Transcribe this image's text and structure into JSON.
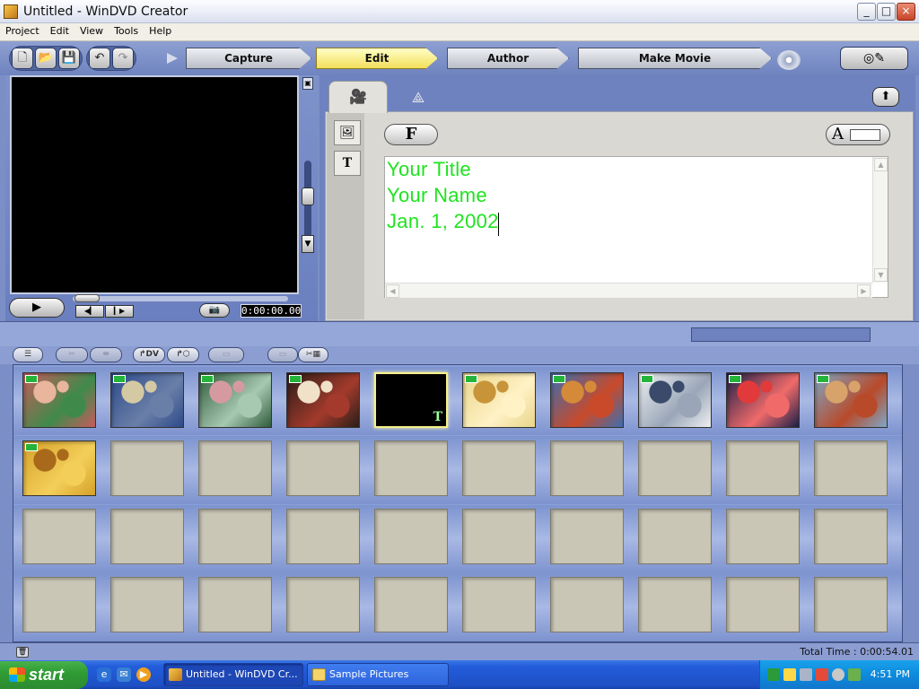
{
  "window": {
    "title": "Untitled - WinDVD Creator"
  },
  "window_controls": {
    "minimize": "_",
    "maximize": "□",
    "close": "×"
  },
  "menu": [
    "Project",
    "Edit",
    "View",
    "Tools",
    "Help"
  ],
  "toolbar": {
    "steps": [
      {
        "label": "Capture",
        "active": false
      },
      {
        "label": "Edit",
        "active": true
      },
      {
        "label": "Author",
        "active": false
      },
      {
        "label": "Make Movie",
        "active": false
      }
    ]
  },
  "preview": {
    "timecode": "0:00:00.00"
  },
  "editor": {
    "font_button": "F",
    "align_button": "A",
    "title_lines": [
      "Your Title",
      "Your Name",
      "Jan. 1, 2002"
    ],
    "text_color": "#1ee31e"
  },
  "clips": [
    {
      "type": "image",
      "colors": [
        "#c75c5c",
        "#e9b59c",
        "#3f8a4b"
      ],
      "badge": true
    },
    {
      "type": "image",
      "colors": [
        "#2d4a8a",
        "#d5c9a3",
        "#6a7fa8"
      ],
      "badge": true
    },
    {
      "type": "image",
      "colors": [
        "#2f5a3a",
        "#d59aa0",
        "#a7c9b2"
      ],
      "badge": true
    },
    {
      "type": "image",
      "colors": [
        "#2a1e18",
        "#f0e1c8",
        "#a33a2c"
      ],
      "badge": true
    },
    {
      "type": "title",
      "selected": true,
      "label": "T"
    },
    {
      "type": "image",
      "colors": [
        "#e9d58a",
        "#c8943a",
        "#fff2c5"
      ],
      "badge": true
    },
    {
      "type": "image",
      "colors": [
        "#3c6fb0",
        "#d58a3a",
        "#c94a2a"
      ],
      "badge": true
    },
    {
      "type": "image",
      "colors": [
        "#eef0f2",
        "#3a4a6a",
        "#9aa6b8"
      ],
      "badge": true
    },
    {
      "type": "image",
      "colors": [
        "#1a1f48",
        "#e23a3a",
        "#f06a6a"
      ],
      "badge": true
    },
    {
      "type": "image",
      "colors": [
        "#7ea8c6",
        "#d7a36a",
        "#b84a2a"
      ],
      "badge": true
    },
    {
      "type": "image",
      "colors": [
        "#d5a12a",
        "#a86a1a",
        "#f3cf5a"
      ],
      "badge": true
    }
  ],
  "status": {
    "total_time": "Total Time : 0:00:54.01"
  },
  "taskbar": {
    "start_label": "start",
    "tasks": [
      {
        "label": "Untitled - WinDVD Cr...",
        "active": true
      },
      {
        "label": "Sample Pictures",
        "active": false
      }
    ],
    "clock": "4:51 PM"
  }
}
